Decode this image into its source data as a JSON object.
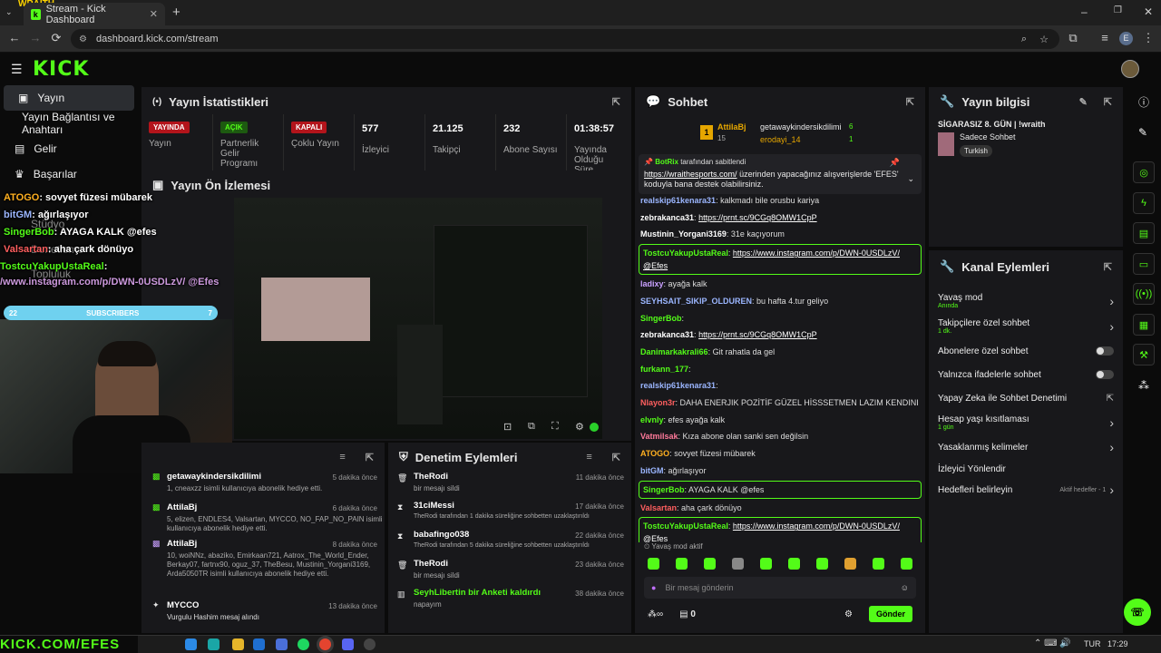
{
  "browser": {
    "tab_title": "Stream - Kick Dashboard",
    "url": "dashboard.kick.com/stream",
    "profile_letter": "E",
    "window_label": "WRAITH"
  },
  "topbar": {
    "logo": "KICK"
  },
  "sidebar": {
    "items": [
      {
        "label": "Yayın",
        "active": true
      },
      {
        "label": "Yayın Bağlantısı ve Anahtarı"
      },
      {
        "label": "Gelir"
      },
      {
        "label": "Başarılar"
      },
      {
        "label": "Stüdyo"
      },
      {
        "label": "Denetleme"
      },
      {
        "label": "Topluluk"
      }
    ]
  },
  "stats": {
    "title": "Yayın İstatistikleri",
    "items": [
      {
        "badge": "YAYINDA",
        "label": "Yayın"
      },
      {
        "badge": "AÇIK",
        "label": "Partnerlik Gelir Programı"
      },
      {
        "badge": "KAPALI",
        "label": "Çoklu Yayın"
      },
      {
        "value": "577",
        "label": "İzleyici"
      },
      {
        "value": "21.125",
        "label": "Takipçi"
      },
      {
        "value": "232",
        "label": "Abone Sayısı"
      },
      {
        "value": "01:38:57",
        "label": "Yayında Olduğu Süre"
      }
    ]
  },
  "preview": {
    "title": "Yayın Ön İzlemesi"
  },
  "overlay": {
    "lines": [
      {
        "user": "ATOGO",
        "text": ": sovyet füzesi mübarek"
      },
      {
        "user": "bitGM",
        "text": ": ağırlaşıyor"
      },
      {
        "user": "SingerBob",
        "text": ": AYAGA KALK @efes"
      },
      {
        "user": "Valsartan",
        "text": ": aha çark dönüyo"
      },
      {
        "user": "TostcuYakupUstaReal",
        "text": ":"
      },
      {
        "user": "",
        "text": "/www.instagram.com/p/DWN-0USDLzV/ @Efes"
      }
    ],
    "sub_left": "22",
    "sub_label": "SUBSCRIBERS",
    "sub_right": "7",
    "footer": "KICK.COM/EFES"
  },
  "events": {
    "items": [
      {
        "name": "getawaykindersikdilimi",
        "time": "5 dakika önce",
        "desc": "1, cneaxzz isimli kullanıcıya abonelik hediye etti."
      },
      {
        "name": "AttilaBj",
        "time": "6 dakika önce",
        "desc": "5, elizen, ENDLES4, Valsartan, MYCCO, NO_FAP_NO_PAIN isimli kullanıcıya abonelik hediye etti."
      },
      {
        "name": "AttilaBj",
        "time": "8 dakika önce",
        "desc": "10, woiNNz, abaziko, Emirkaan721, Aatrox_The_World_Ender, Berkay07, fartnx90, oguz_37, TheBesu, Mustinin_Yorgani3169, Arda5050TR isimli kullanıcıya abonelik hediye etti."
      },
      {
        "name": "MYCCO",
        "time": "13 dakika önce",
        "desc": "Vurgulu Hashim mesaj alındı"
      }
    ]
  },
  "moderation": {
    "title": "Denetim Eylemleri",
    "items": [
      {
        "name": "TheRodi",
        "time": "11 dakika önce",
        "desc": "bir mesajı sildi"
      },
      {
        "name": "31ciMessi",
        "time": "17 dakika önce",
        "desc": "TheRodi tarafından 1 dakika süreliğine sohbetten uzaklaştırıldı"
      },
      {
        "name": "babafingo038",
        "time": "22 dakika önce",
        "desc": "TheRodi tarafından 5 dakika süreliğine sohbetten uzaklaştırıldı"
      },
      {
        "name": "TheRodi",
        "time": "23 dakika önce",
        "desc": "bir mesajı sildi"
      },
      {
        "name": "SeyhLibertin bir Anketi kaldırdı",
        "time": "38 dakika önce",
        "desc": "napayım"
      }
    ]
  },
  "chat": {
    "title": "Sohbet",
    "leaders": [
      {
        "rank": "1",
        "name": "AttilaBj",
        "sub": "15"
      },
      {
        "name": "getawaykindersikdilimi",
        "count": "6"
      },
      {
        "name": "erodayi_14",
        "count": "1"
      }
    ],
    "pinned": {
      "by": "BotRix",
      "by_suffix": "tarafından sabitlendi",
      "link": "https://wraithesports.com/",
      "text": "üzerinden yapacağınız alışverişlerde 'EFES' koduyla bana destek olabilirsiniz."
    },
    "messages": [
      {
        "user": "realskip61kenara31",
        "color": "#9bb6ff",
        "text": "kalkmadı bile orusbu kariya"
      },
      {
        "user": "zebrakanca31",
        "color": "#fff",
        "text": "https://prnt.sc/9CGq8OMW1CpP",
        "link": true
      },
      {
        "user": "Mustinin_Yorgani3169",
        "color": "#fff",
        "text": "31e kaçıyorum"
      },
      {
        "user": "TostcuYakupUstaReal",
        "color": "#53fc18",
        "text": "https://www.instagram.com/p/DWN-0USDLzV/ @Efes",
        "link": true,
        "highlight": true
      },
      {
        "user": "ladixy",
        "color": "#c9a0ff",
        "text": "ayağa kalk"
      },
      {
        "user": "SEYHSAIT_SIKIP_OLDUREN",
        "color": "#9bb6ff",
        "text": "bu hafta 4.tur geliyo"
      },
      {
        "user": "SingerBob",
        "color": "#53fc18",
        "text": ""
      },
      {
        "user": "zebrakanca31",
        "color": "#fff",
        "text": "https://prnt.sc/9CGq8OMW1CpP",
        "link": true
      },
      {
        "user": "Danimarkakrali66",
        "color": "#53fc18",
        "text": "Git rahatla da gel"
      },
      {
        "user": "furkann_177",
        "color": "#53fc18",
        "text": ""
      },
      {
        "user": "realskip61kenara31",
        "color": "#9bb6ff",
        "text": ""
      },
      {
        "user": "Nlayon3r",
        "color": "#ff5f5f",
        "text": "DAHA ENERJIK POZİTİF GÜZEL HİSSSETMEN LAZIM KENDINI"
      },
      {
        "user": "elvnly",
        "color": "#53fc18",
        "text": "efes ayağa kalk"
      },
      {
        "user": "Vatmilsak",
        "color": "#ff7a9a",
        "text": "Kıza abone olan sanki sen değilsin"
      },
      {
        "user": "ATOGO",
        "color": "#ffb020",
        "text": "sovyet füzesi mübarek"
      },
      {
        "user": "bitGM",
        "color": "#9bb6ff",
        "text": "ağırlaşıyor"
      },
      {
        "user": "SingerBob",
        "color": "#53fc18",
        "text": "AYAGA KALK @efes",
        "highlight": true
      },
      {
        "user": "Valsartan",
        "color": "#ff5f5f",
        "text": "aha çark dönüyo"
      },
      {
        "user": "TostcuYakupUstaReal",
        "color": "#53fc18",
        "text": "https://www.instagram.com/p/DWN-0USDLzV/ @Efes",
        "link": true,
        "highlight": true
      }
    ],
    "slow_mode": "Yavaş mod aktif",
    "input_placeholder": "Bir mesaj gönderin",
    "points": "0",
    "send": "Gönder"
  },
  "stream_info": {
    "title": "Yayın bilgisi",
    "stream_title": "SİGARASIZ 8. GÜN | !wraith",
    "category": "Sadece Sohbet",
    "tag": "Turkish"
  },
  "channel_actions": {
    "title": "Kanal Eylemleri",
    "items": [
      {
        "label": "Yavaş mod",
        "sub": "Anında",
        "kind": "arrow"
      },
      {
        "label": "Takipçilere özel sohbet",
        "sub": "1 dk.",
        "kind": "arrow"
      },
      {
        "label": "Abonelere özel sohbet",
        "kind": "toggle"
      },
      {
        "label": "Yalnızca ifadelerle sohbet",
        "kind": "toggle"
      },
      {
        "label": "Yapay Zeka ile Sohbet Denetimi",
        "kind": "ext"
      },
      {
        "label": "Hesap yaşı kısıtlaması",
        "sub": "1 gün",
        "kind": "arrow"
      },
      {
        "label": "Yasaklanmış kelimeler",
        "kind": "arrow"
      },
      {
        "label": "İzleyici Yönlendir",
        "kind": "none"
      },
      {
        "label": "Hedefleri belirleyin",
        "extra": "Aktif hedefler - 1",
        "kind": "arrow"
      }
    ]
  },
  "taskbar": {
    "lang": "TUR",
    "time": "17:29"
  }
}
